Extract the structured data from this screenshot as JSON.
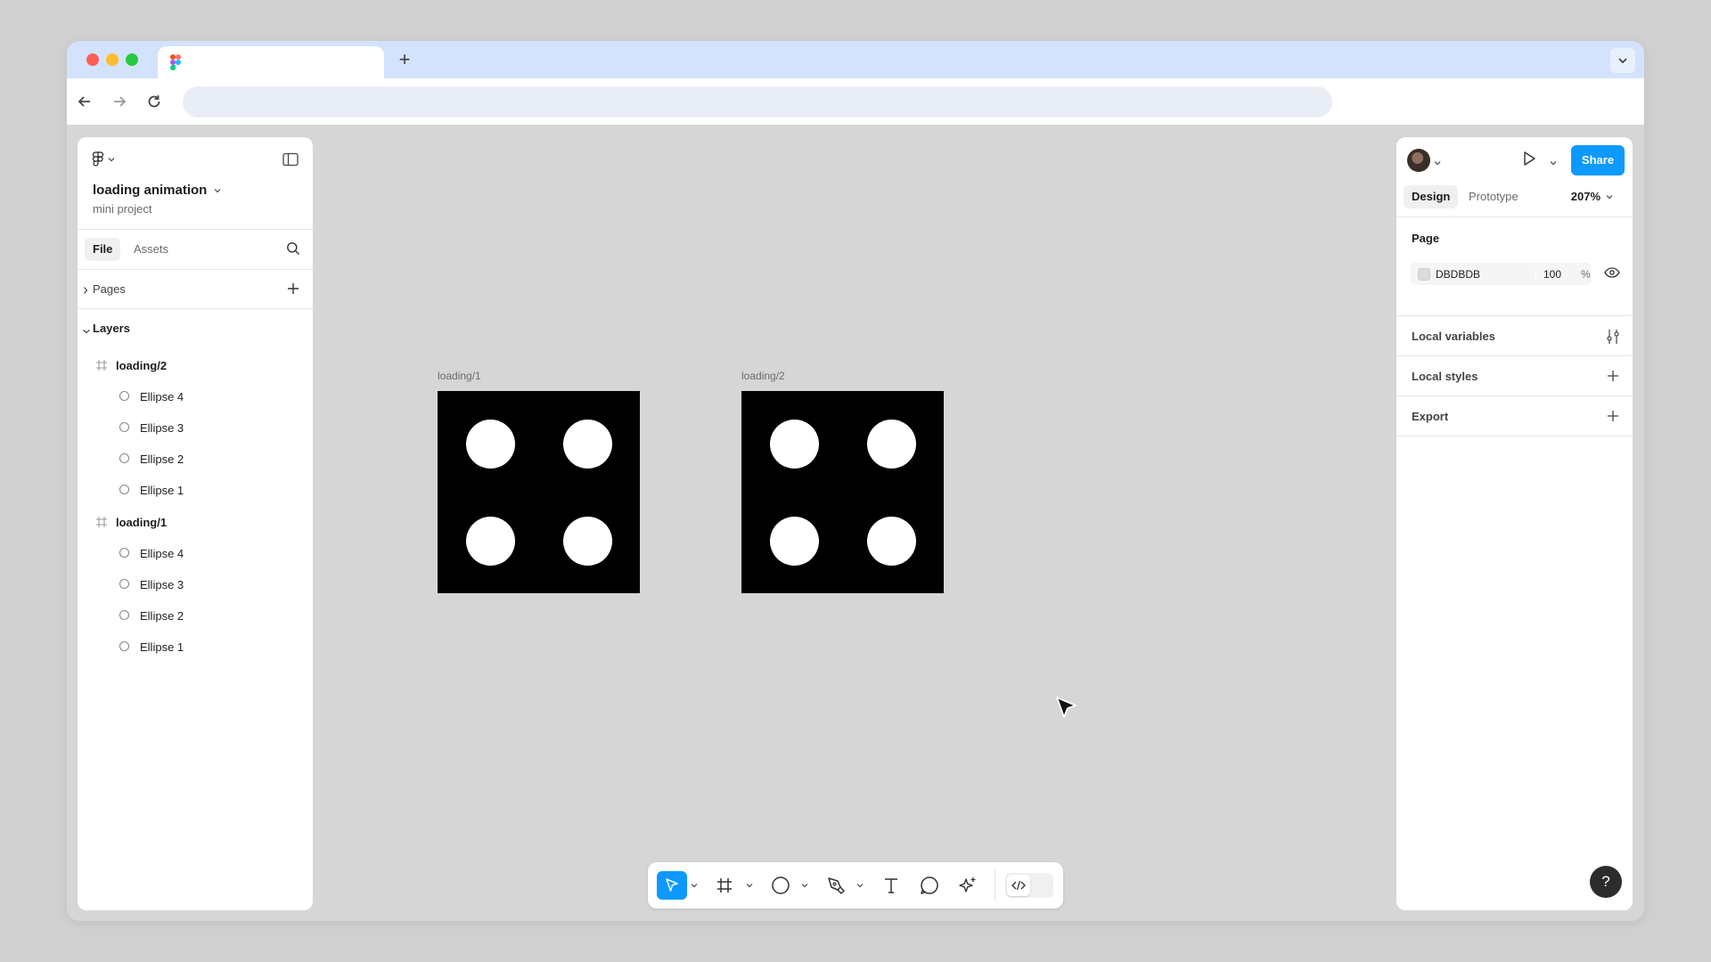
{
  "browser": {
    "tab_title": "",
    "url": "",
    "new_tab_label": "+"
  },
  "left_panel": {
    "file_name": "loading animation",
    "project_name": "mini project",
    "tabs": [
      "File",
      "Assets"
    ],
    "pages_label": "Pages",
    "layers_label": "Layers",
    "layers": [
      {
        "name": "loading/2",
        "type": "frame"
      },
      {
        "name": "Ellipse 4",
        "type": "ellipse"
      },
      {
        "name": "Ellipse 3",
        "type": "ellipse"
      },
      {
        "name": "Ellipse 2",
        "type": "ellipse"
      },
      {
        "name": "Ellipse 1",
        "type": "ellipse"
      },
      {
        "name": "loading/1",
        "type": "frame"
      },
      {
        "name": "Ellipse 4",
        "type": "ellipse"
      },
      {
        "name": "Ellipse 3",
        "type": "ellipse"
      },
      {
        "name": "Ellipse 2",
        "type": "ellipse"
      },
      {
        "name": "Ellipse 1",
        "type": "ellipse"
      }
    ]
  },
  "canvas": {
    "frames": [
      {
        "label": "loading/1"
      },
      {
        "label": "loading/2"
      }
    ],
    "frame_color": "#000000",
    "dot_color": "#FFFFFF"
  },
  "right_panel": {
    "share_label": "Share",
    "tabs": [
      "Design",
      "Prototype"
    ],
    "zoom": "207%",
    "page_section_title": "Page",
    "page_color_hex": "DBDBDB",
    "page_color_opacity": "100",
    "opacity_unit": "%",
    "rows": [
      {
        "label": "Local variables",
        "action_icon": "sliders-icon"
      },
      {
        "label": "Local styles",
        "action_icon": "plus-icon"
      },
      {
        "label": "Export",
        "action_icon": "plus-icon"
      }
    ],
    "help_label": "?"
  },
  "colors": {
    "accent": "#0d99ff",
    "tabbar": "#d3e3fd",
    "canvas": "#d6d6d6"
  }
}
